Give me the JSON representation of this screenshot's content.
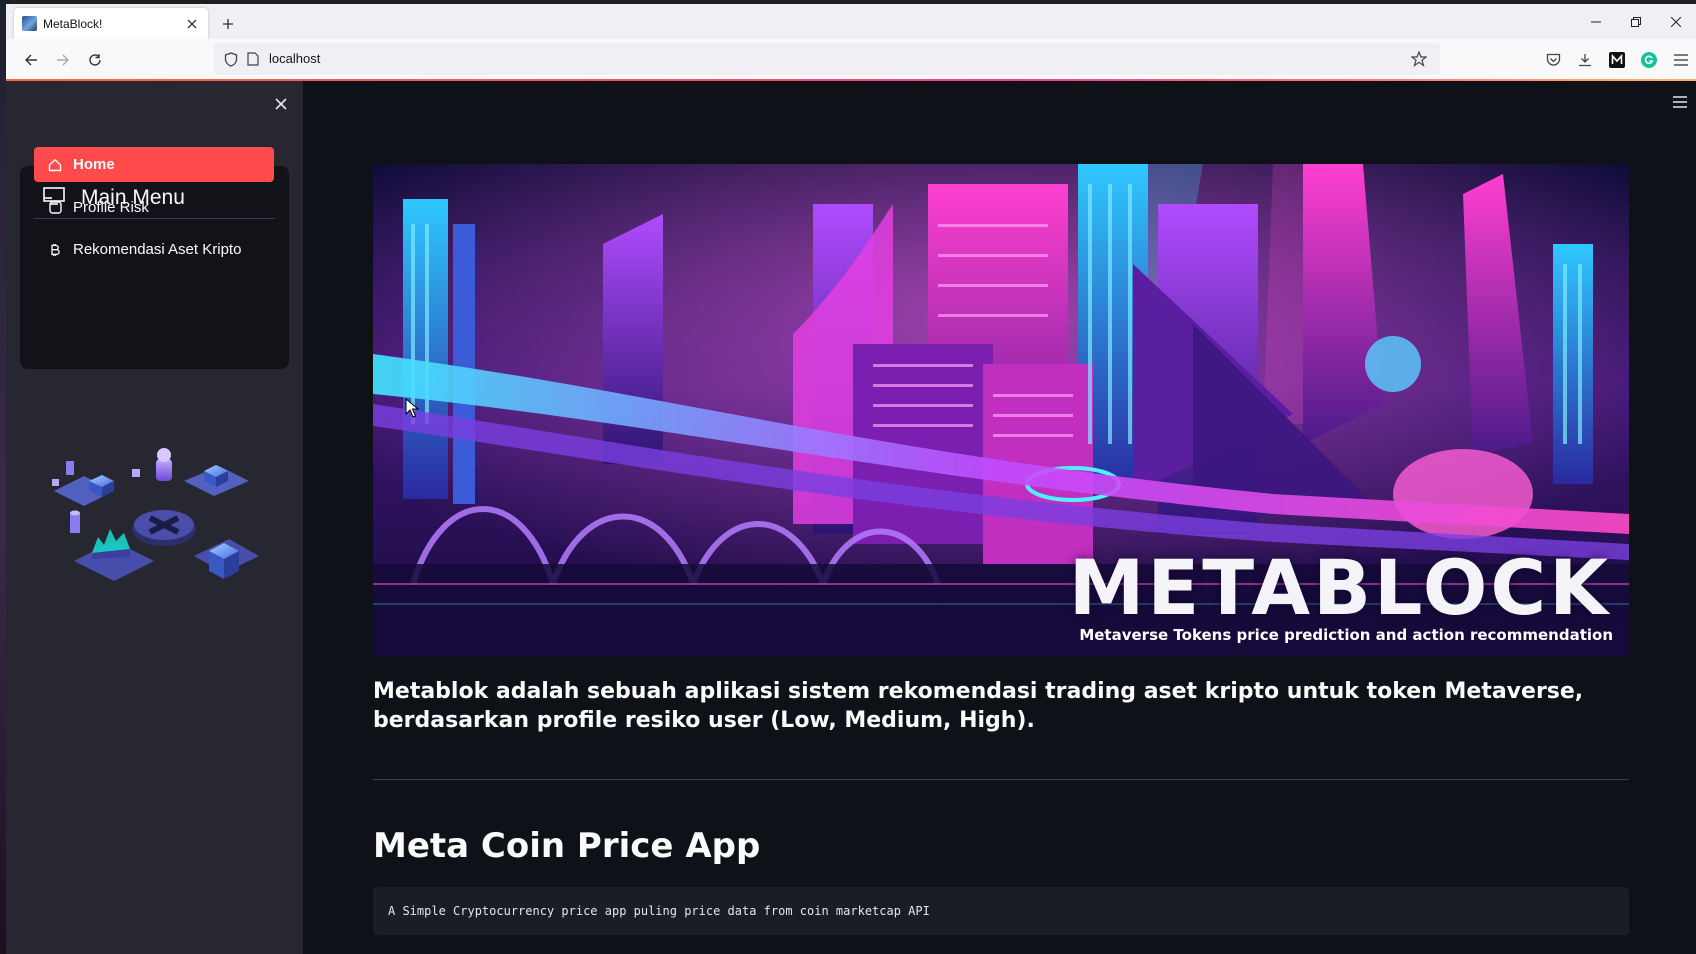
{
  "browser": {
    "tab_title": "MetaBlock!",
    "url": "localhost",
    "icons": [
      "back-icon",
      "forward-icon",
      "reload-icon",
      "shield-icon",
      "page-icon",
      "bookmark-star-icon",
      "pocket-icon",
      "download-icon",
      "extension-m-icon",
      "extension-grammarly-icon",
      "menu-icon",
      "minimize-icon",
      "restore-icon",
      "close-icon"
    ],
    "loading_bar_color": "#ff4b4b"
  },
  "sidebar": {
    "menu_title": "Main Menu",
    "items": [
      {
        "label": "Home",
        "icon": "house-icon",
        "active": true
      },
      {
        "label": "Profile Risk",
        "icon": "square-icon",
        "active": false
      },
      {
        "label": "Rekomendasi Aset Kripto",
        "icon": "bitcoin-icon",
        "active": false
      }
    ],
    "accent": "#ff4b4b",
    "illustration": "isometric-crypto-illustration"
  },
  "main": {
    "banner": {
      "title": "METABLOCK",
      "subtitle": "Metaverse Tokens price prediction and action recommendation"
    },
    "intro_text": "Metablok adalah sebuah aplikasi sistem rekomendasi trading aset kripto untuk token Metaverse, berdasarkan profile resiko user (Low, Medium, High).",
    "heading": "Meta Coin Price App",
    "code_text": "A Simple Cryptocurrency price app puling price data from coin marketcap API"
  }
}
